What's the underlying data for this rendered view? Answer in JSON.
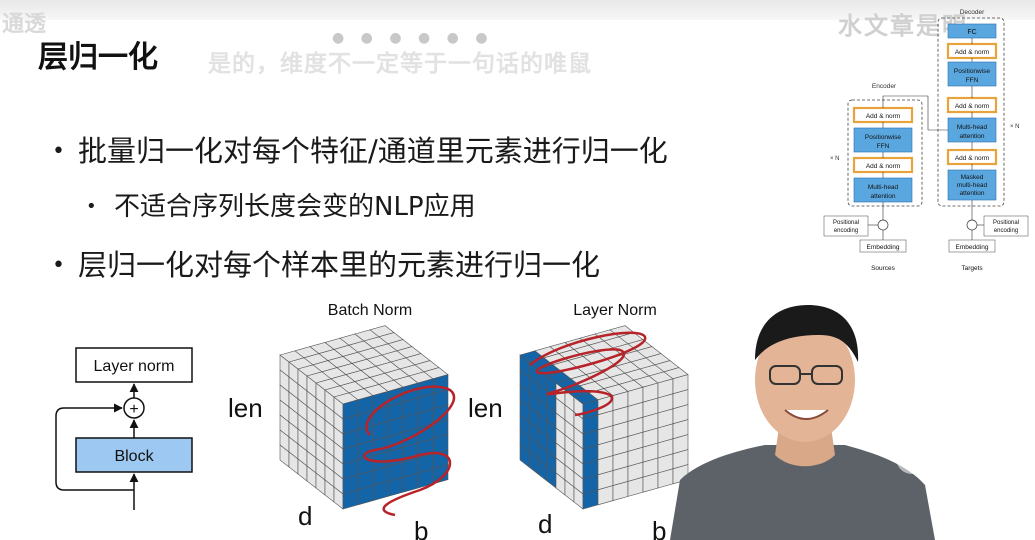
{
  "slide": {
    "title": "层归一化",
    "watermark_left": "通透",
    "watermark_right": "水文章是明",
    "caption": "是的，维度不一定等于一句话的唯鼠",
    "bullets": [
      "批量归一化对每个特征/通道里元素进行归一化",
      "不适合序列长度会变的NLP应用",
      "层归一化对每个样本里的元素进行归一化"
    ]
  },
  "block_diagram": {
    "layer_norm": "Layer norm",
    "plus": "+",
    "block": "Block"
  },
  "norm_figures": {
    "batch_title": "Batch Norm",
    "layer_title": "Layer Norm",
    "len_label": "len",
    "d_label": "d",
    "b_label": "b",
    "grid_color": "#e6e6e6",
    "highlight_color": "#1464a8",
    "scribble_color": "#b8232a"
  },
  "transformer": {
    "decoder_label": "Decoder",
    "encoder_label": "Encoder",
    "repeat_label": "× N",
    "add_norm": "Add & norm",
    "ffn_line1": "Positionwise",
    "ffn_line2": "FFN",
    "mha_line1": "Multi-head",
    "mha_line2": "attention",
    "masked_line1": "Masked",
    "masked_line2": "multi-head",
    "masked_line3": "attention",
    "pos_enc_line1": "Positional",
    "pos_enc_line2": "encoding",
    "embedding": "Embedding",
    "sources": "Sources",
    "targets": "Targets",
    "fc_label": "FC",
    "box_color": "#5aa7e0",
    "highlight_color": "#e8a33c"
  }
}
